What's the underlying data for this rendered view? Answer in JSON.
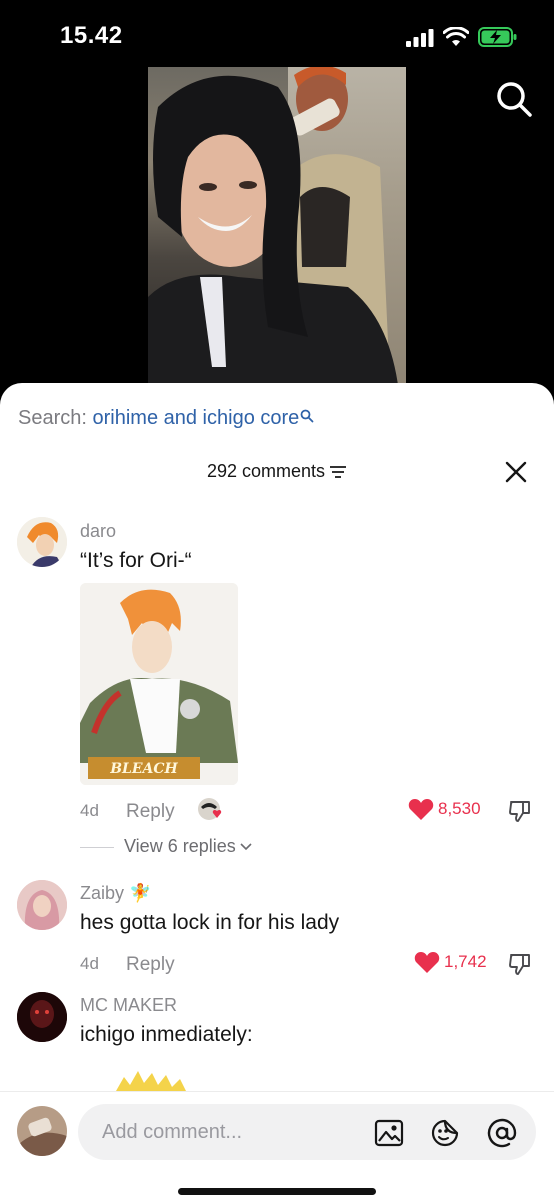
{
  "status_bar": {
    "time": "15.42"
  },
  "sheet": {
    "search": {
      "prefix": "Search:",
      "query": "orihime and ichigo core"
    },
    "comments_count": "292 comments",
    "comments": [
      {
        "username": "daro",
        "text": "“It’s for Ori-“",
        "age": "4d",
        "reply_label": "Reply",
        "likes": "8,530",
        "view_replies": "View 6 replies",
        "image_caption": "BLEACH"
      },
      {
        "username": "Zaiby 🧚",
        "text": "hes gotta lock in for his lady",
        "age": "4d",
        "reply_label": "Reply",
        "likes": "1,742"
      },
      {
        "username": "MC MAKER",
        "text": "ichigo inmediately:"
      }
    ]
  },
  "bottom_bar": {
    "placeholder": "Add comment..."
  },
  "icons": {
    "search": "search-icon",
    "close": "close-icon",
    "filter": "filter-icon",
    "heart": "heart-icon",
    "dislike": "thumbs-down-icon",
    "image": "image-icon",
    "sticker": "emoji-sticker-icon",
    "mention": "at-mention-icon"
  },
  "colors": {
    "accent_link": "#2f62a8",
    "like_red": "#e8304d",
    "text": "#161616",
    "muted": "#8a8a8e"
  }
}
